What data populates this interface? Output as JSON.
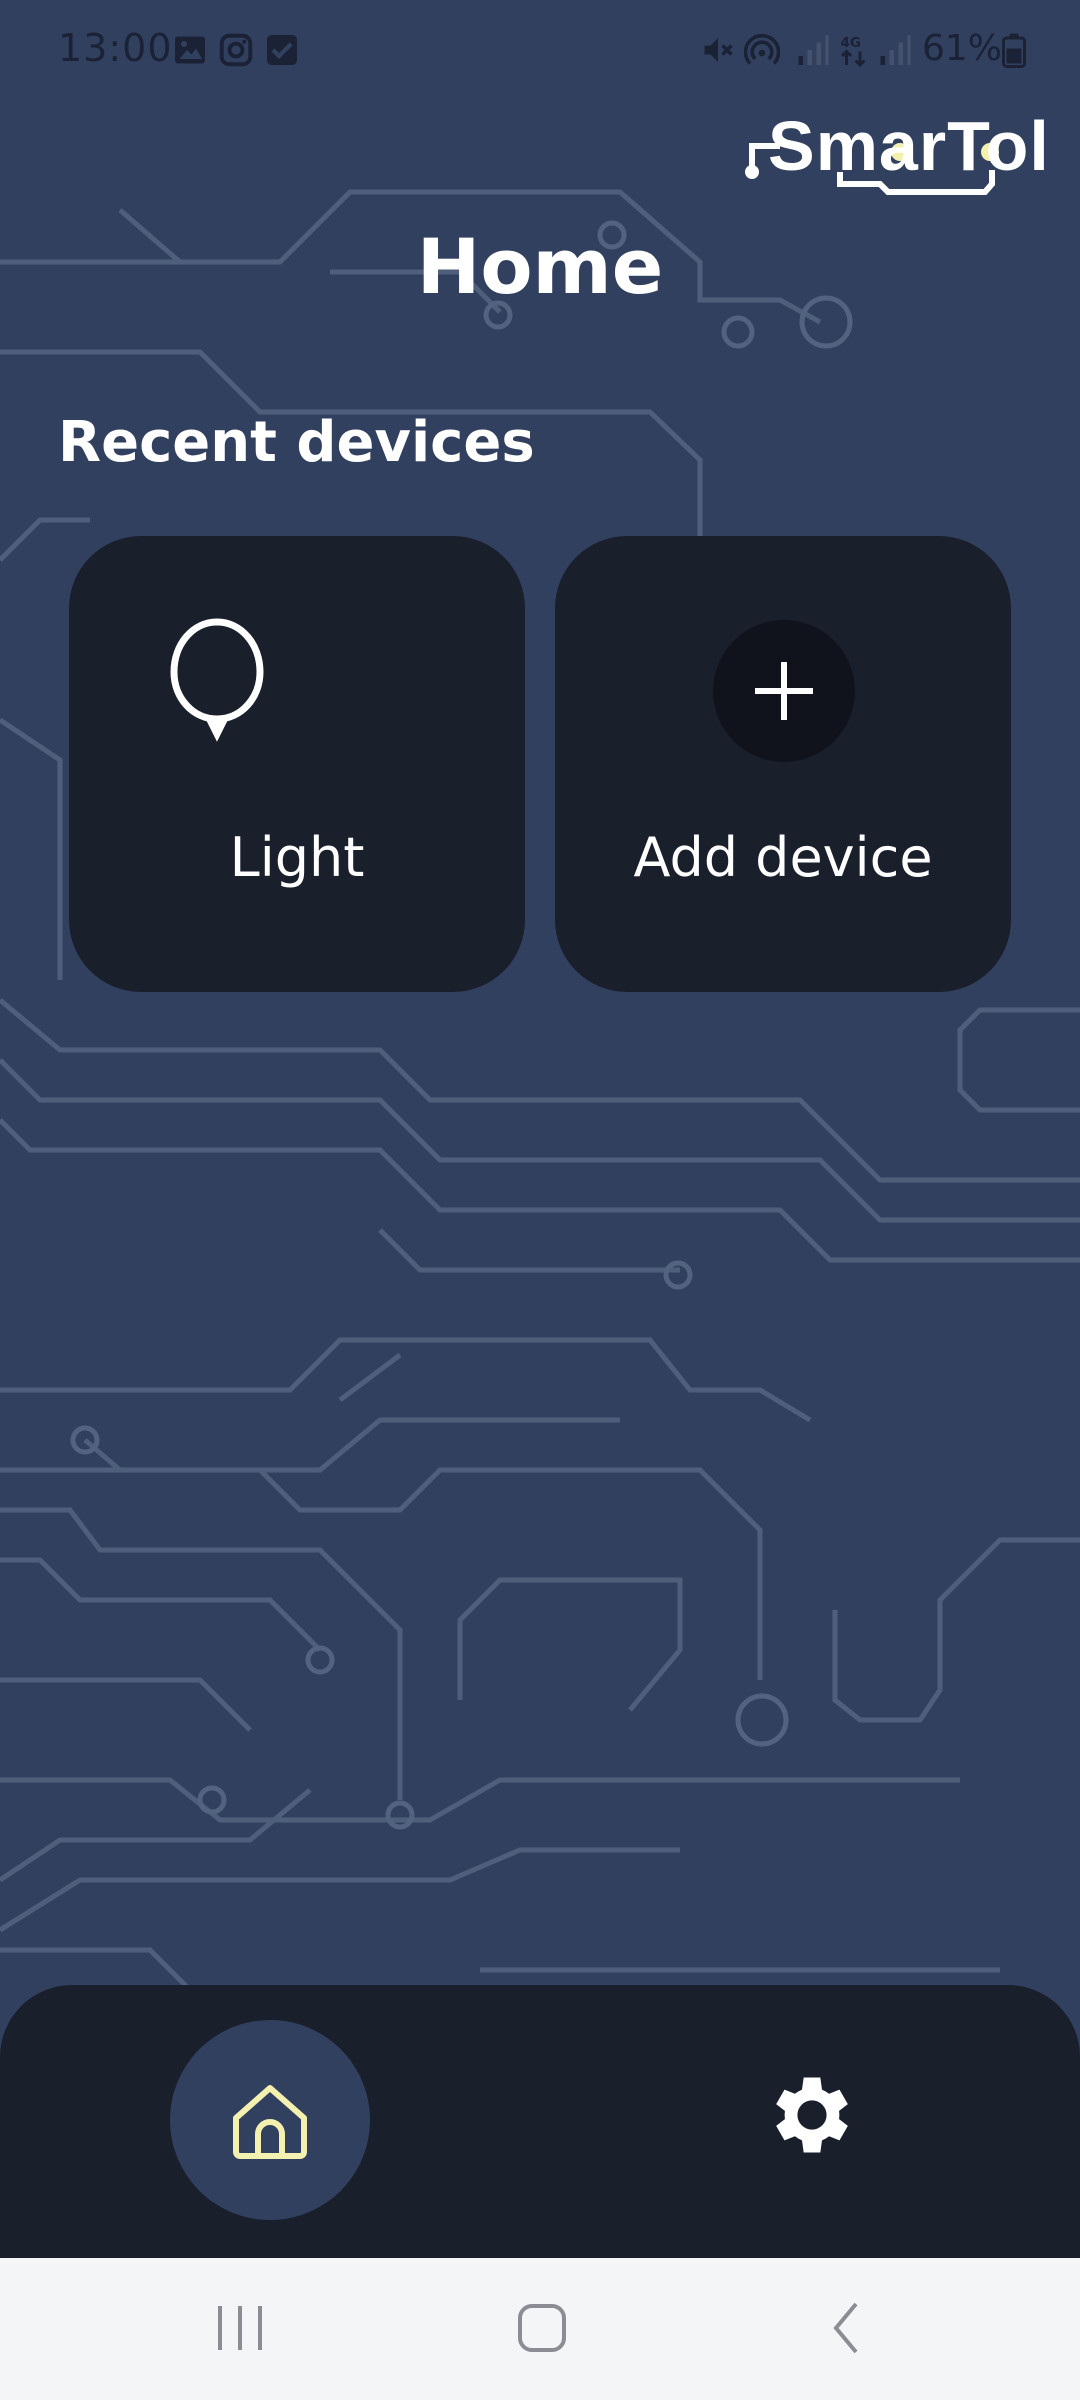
{
  "status_bar": {
    "time": "13:00",
    "battery_text": "61%",
    "left_icons": [
      "gallery-icon",
      "instagram-icon",
      "checkbox-icon"
    ],
    "right_icons": [
      "mute-icon",
      "hotspot-icon",
      "signal-icon",
      "4g-icon",
      "signal-icon",
      "battery-icon"
    ]
  },
  "logo": {
    "text": "SmarTol",
    "accent_color": "#f4f0b0"
  },
  "header": {
    "title": "Home"
  },
  "recent": {
    "title": "Recent devices",
    "devices": [
      {
        "label": "Light",
        "icon": "lightbulb-icon"
      },
      {
        "label": "Add device",
        "icon": "plus-icon"
      }
    ]
  },
  "bottom_nav": {
    "items": [
      {
        "icon": "home-icon",
        "selected": true
      },
      {
        "icon": "gear-icon",
        "selected": false
      }
    ]
  },
  "system_nav": {
    "items": [
      "recents-icon",
      "home-icon",
      "back-icon"
    ]
  },
  "colors": {
    "background": "#31405f",
    "card": "#1a1f2c",
    "accent": "#f4f0b0",
    "text": "#ffffff"
  }
}
